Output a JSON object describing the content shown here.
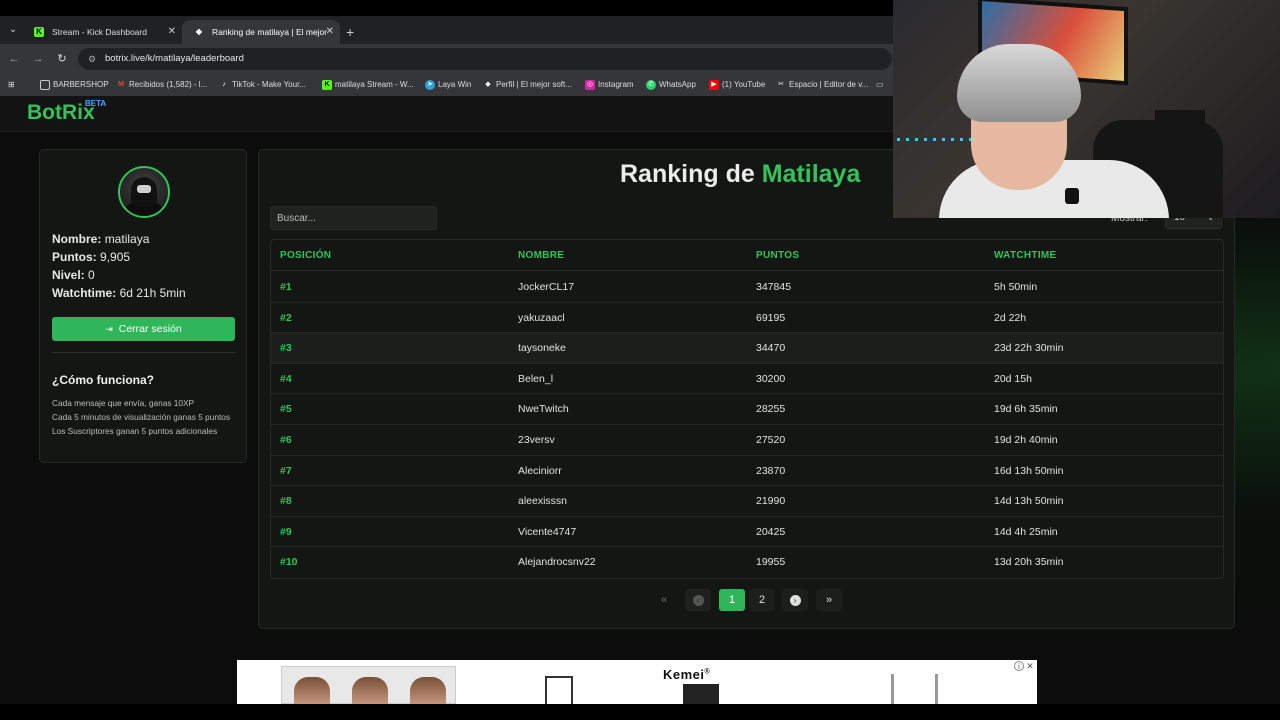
{
  "browser": {
    "tabs": [
      {
        "title": "Stream - Kick Dashboard",
        "favicon": "K"
      },
      {
        "title": "Ranking de matilaya | El mejor",
        "favicon": "◆"
      }
    ],
    "url": "botrix.live/k/matilaya/leaderboard",
    "bookmarks": [
      {
        "label": "BARBERSHOP",
        "icon": "folder-icon"
      },
      {
        "label": "Recibidos (1,582) - l...",
        "icon": "gmail-icon"
      },
      {
        "label": "TikTok - Make Your...",
        "icon": "tiktok-icon"
      },
      {
        "label": "matilaya Stream - W...",
        "icon": "kick-icon"
      },
      {
        "label": "Laya Win",
        "icon": "telegram-icon"
      },
      {
        "label": "Perfil | El mejor soft...",
        "icon": "botrix-icon"
      },
      {
        "label": "Instagram",
        "icon": "instagram-icon"
      },
      {
        "label": "WhatsApp",
        "icon": "whatsapp-icon"
      },
      {
        "label": "(1) YouTube",
        "icon": "youtube-icon"
      },
      {
        "label": "Espacio | Editor de v...",
        "icon": "capcut-icon"
      }
    ]
  },
  "site": {
    "logo": "BotRix",
    "logo_badge": "BETA",
    "accent_color": "#33c35a"
  },
  "profile": {
    "name_label": "Nombre:",
    "name_value": "matilaya",
    "points_label": "Puntos:",
    "points_value": "9,905",
    "level_label": "Nivel:",
    "level_value": "0",
    "watchtime_label": "Watchtime:",
    "watchtime_value": "6d 21h 5min",
    "logout_label": "Cerrar sesión",
    "how_title": "¿Cómo funciona?",
    "how_lines": [
      "Cada mensaje que envía, ganas 10XP",
      "Cada 5 minutos de visualización ganas 5 puntos",
      "Los Suscriptores ganan 5 puntos adicionales"
    ]
  },
  "leaderboard": {
    "title_prefix": "Ranking de",
    "title_name": "Matilaya",
    "search_placeholder": "Buscar...",
    "show_label": "Mostrar:",
    "show_value": "10",
    "columns": [
      "POSICIÓN",
      "NOMBRE",
      "PUNTOS",
      "WATCHTIME"
    ],
    "rows": [
      {
        "pos": "#1",
        "name": "JockerCL17",
        "points": "347845",
        "watchtime": "5h 50min"
      },
      {
        "pos": "#2",
        "name": "yakuzaacl",
        "points": "69195",
        "watchtime": "2d 22h"
      },
      {
        "pos": "#3",
        "name": "taysoneke",
        "points": "34470",
        "watchtime": "23d 22h 30min"
      },
      {
        "pos": "#4",
        "name": "Belen_l",
        "points": "30200",
        "watchtime": "20d 15h"
      },
      {
        "pos": "#5",
        "name": "NweTwitch",
        "points": "28255",
        "watchtime": "19d 6h 35min"
      },
      {
        "pos": "#6",
        "name": "23versv",
        "points": "27520",
        "watchtime": "19d 2h 40min"
      },
      {
        "pos": "#7",
        "name": "Aleciniorr",
        "points": "23870",
        "watchtime": "16d 13h 50min"
      },
      {
        "pos": "#8",
        "name": "aleexisssn",
        "points": "21990",
        "watchtime": "14d 13h 50min"
      },
      {
        "pos": "#9",
        "name": "Vicente4747",
        "points": "20425",
        "watchtime": "14d 4h 25min"
      },
      {
        "pos": "#10",
        "name": "Alejandrocsnv22",
        "points": "19955",
        "watchtime": "13d 20h 35min"
      }
    ],
    "pagination": {
      "first": "«",
      "prev": "‹",
      "pages": [
        "1",
        "2"
      ],
      "current": "1",
      "next": "›",
      "last": "»"
    }
  },
  "ad": {
    "brand": "Kemei",
    "brand_mark": "®"
  }
}
